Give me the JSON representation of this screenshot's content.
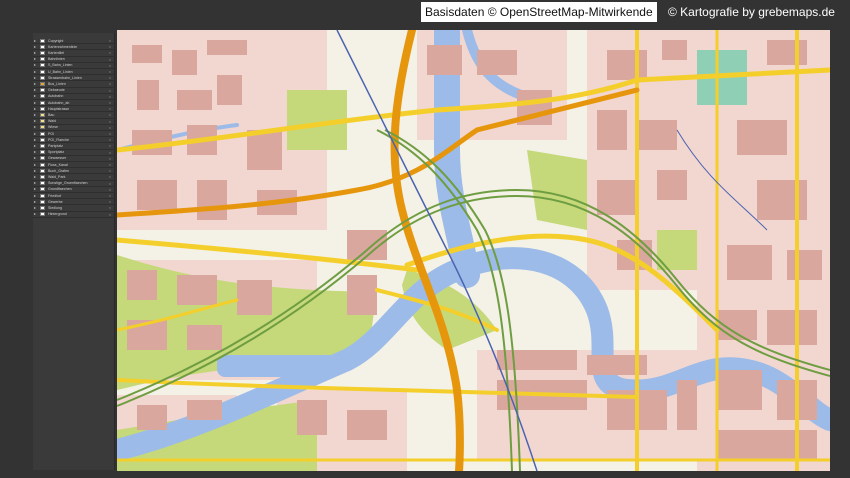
{
  "credits": {
    "osm": "Basisdaten © OpenStreetMap-Mitwirkende",
    "carto": "© Kartografie by grebemaps.de"
  },
  "colors": {
    "background": "#333333",
    "panel": "#3a3a3a",
    "land": "#f4f1e6",
    "water": "#9cbbe8",
    "park": "#c5d97a",
    "building": "#d9a79d",
    "residential": "#f2d6d0",
    "road_major": "#f4cf2c",
    "road_trunk": "#e6960c",
    "rail": "#6f9d41"
  },
  "layers": [
    {
      "name": "Copyright",
      "color": "#ffffff"
    },
    {
      "name": "Kartenrahmenlinie",
      "color": "#ffffff"
    },
    {
      "name": "Kartentitel",
      "color": "#ffffff"
    },
    {
      "name": "Bahnlinien",
      "color": "#ffffff"
    },
    {
      "name": "S_Bahn_Linien",
      "color": "#ffffff"
    },
    {
      "name": "U_Bahn_Linien",
      "color": "#ffffff"
    },
    {
      "name": "Strassenbahn_Linien",
      "color": "#ffffff"
    },
    {
      "name": "Bus_Linien",
      "color": "#e9a22a"
    },
    {
      "name": "Gebaeude",
      "color": "#ffffff"
    },
    {
      "name": "Autobahn",
      "color": "#ffffff"
    },
    {
      "name": "Autobahn_ab",
      "color": "#ffffff"
    },
    {
      "name": "Hauptstrasse",
      "color": "#ffffff"
    },
    {
      "name": "Bau",
      "color": "#f2e38a"
    },
    {
      "name": "Wald",
      "color": "#f2e38a"
    },
    {
      "name": "Wiese",
      "color": "#f2e38a"
    },
    {
      "name": "POI",
      "color": "#ffffff"
    },
    {
      "name": "POI_Flaeche",
      "color": "#ffffff"
    },
    {
      "name": "Parkplatz",
      "color": "#ffffff"
    },
    {
      "name": "Sportplatz",
      "color": "#ffffff"
    },
    {
      "name": "Gewaesser",
      "color": "#ffffff"
    },
    {
      "name": "Fluss_Kanal",
      "color": "#ffffff"
    },
    {
      "name": "Buch_Grafen",
      "color": "#ffffff"
    },
    {
      "name": "Wald_Park",
      "color": "#ffffff"
    },
    {
      "name": "Sonstige_Gruenflaechen",
      "color": "#ffffff"
    },
    {
      "name": "Grundflaechen",
      "color": "#ffffff"
    },
    {
      "name": "Friedhof",
      "color": "#ffffff"
    },
    {
      "name": "Gewerbe",
      "color": "#ffffff"
    },
    {
      "name": "Siedlung",
      "color": "#ffffff"
    },
    {
      "name": "Hintergrund",
      "color": "#ffffff"
    }
  ]
}
